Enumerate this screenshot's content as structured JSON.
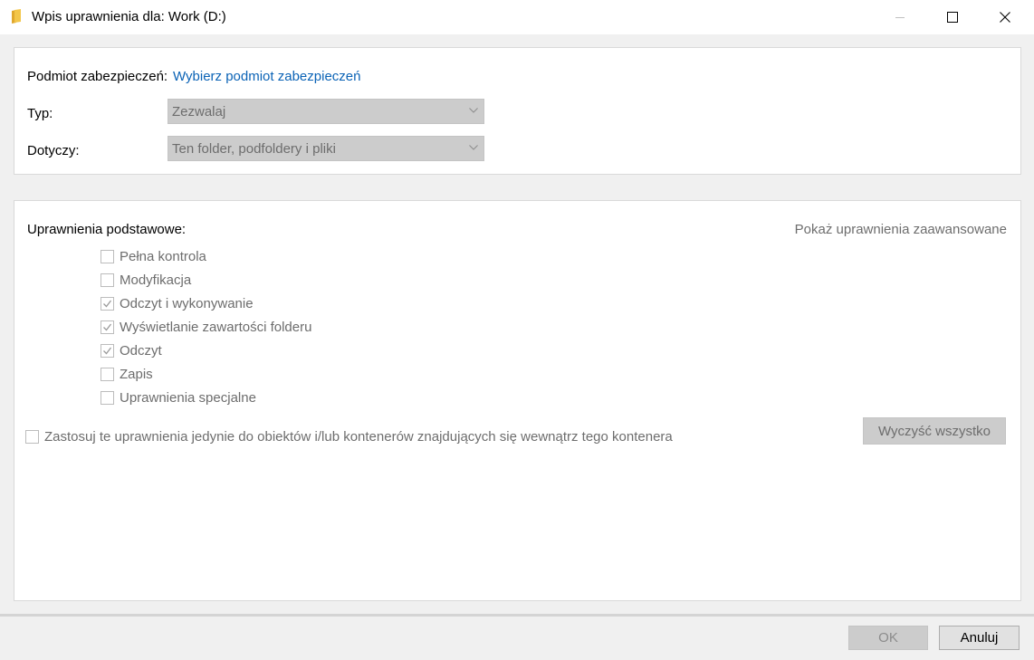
{
  "window": {
    "title": "Wpis uprawnienia dla: Work (D:)",
    "icon": "folder-icon",
    "controls": [
      "minimize-icon",
      "maximize-icon",
      "close-icon"
    ]
  },
  "principal": {
    "label": "Podmiot zabezpieczeń:",
    "link": "Wybierz podmiot zabezpieczeń"
  },
  "type": {
    "label": "Typ:",
    "value": "Zezwalaj"
  },
  "applies": {
    "label": "Dotyczy:",
    "value": "Ten folder, podfoldery i pliki"
  },
  "permissions": {
    "heading": "Uprawnienia podstawowe:",
    "advanced_link": "Pokaż uprawnienia zaawansowane",
    "items": [
      {
        "label": "Pełna kontrola",
        "checked": false
      },
      {
        "label": "Modyfikacja",
        "checked": false
      },
      {
        "label": "Odczyt i wykonywanie",
        "checked": true
      },
      {
        "label": "Wyświetlanie zawartości folderu",
        "checked": true
      },
      {
        "label": "Odczyt",
        "checked": true
      },
      {
        "label": "Zapis",
        "checked": false
      },
      {
        "label": "Uprawnienia specjalne",
        "checked": false
      }
    ],
    "apply_inside": {
      "label": "Zastosuj te uprawnienia jedynie do obiektów i/lub kontenerów znajdujących się wewnątrz tego kontenera",
      "checked": false
    },
    "clear_all": "Wyczyść wszystko"
  },
  "footer": {
    "ok": "OK",
    "cancel": "Anuluj"
  },
  "colors": {
    "link": "#0b63b6",
    "disabled_text": "#6d6d6d",
    "disabled_bg": "#cccccc",
    "folder": "#f3c64a"
  }
}
